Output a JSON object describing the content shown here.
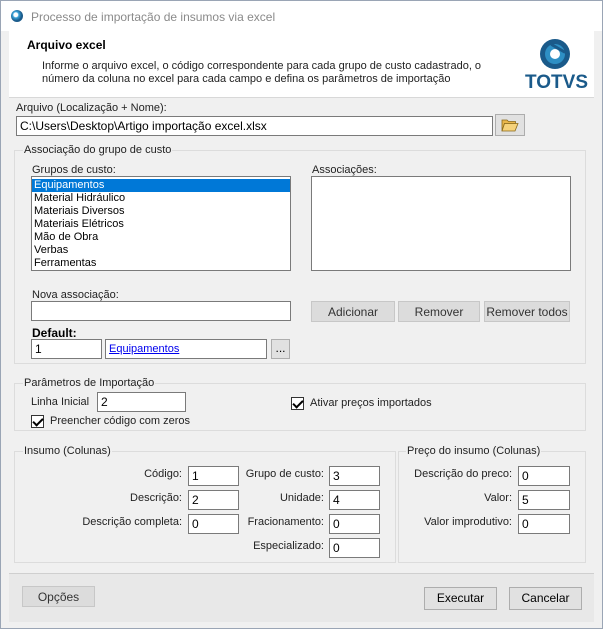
{
  "window": {
    "title": "Processo de importação de insumos via excel"
  },
  "header": {
    "title": "Arquivo excel",
    "description": "Informe o arquivo excel, o código correspondente para cada grupo de custo cadastrado, o número da coluna no excel para cada campo e defina os parâmetros de importação",
    "logo_text": "TOTVS",
    "logo_color": "#1a5a8a"
  },
  "arquivo": {
    "label": "Arquivo (Localização + Nome):",
    "value": "C:\\Users\\Desktop\\Artigo importação excel.xlsx",
    "browse_icon": "folder-open-icon"
  },
  "associacao": {
    "title": "Associação do grupo de custo",
    "grupos_label": "Grupos de custo:",
    "grupos": [
      "Equipamentos",
      "Material Hidráulico",
      "Materiais Diversos",
      "Materiais Elétricos",
      "Mão de Obra",
      "Verbas",
      "Ferramentas"
    ],
    "selected_grupo": "Equipamentos",
    "associacoes_label": "Associações:",
    "nova_label": "Nova associação:",
    "nova_value": "",
    "default_label": "Default:",
    "default_code": "1",
    "default_link": "Equipamentos",
    "ellipsis": "...",
    "btn_adicionar": "Adicionar",
    "btn_remover": "Remover",
    "btn_remover_todos": "Remover todos"
  },
  "parametros": {
    "title": "Parâmetros de Importação",
    "linha_label": "Linha Inicial",
    "linha_value": "2",
    "ativar_label": "Ativar preços importados",
    "ativar_checked": true,
    "preencher_label": "Preencher código com zeros",
    "preencher_checked": true
  },
  "insumo": {
    "title": "Insumo (Colunas)",
    "codigo_label": "Código:",
    "codigo": "1",
    "descricao_label": "Descrição:",
    "descricao": "2",
    "desc_completa_label": "Descrição completa:",
    "desc_completa": "0",
    "grupo_label": "Grupo de custo:",
    "grupo": "3",
    "unidade_label": "Unidade:",
    "unidade": "4",
    "fracionamento_label": "Fracionamento:",
    "fracionamento": "0",
    "especializado_label": "Especializado:",
    "especializado": "0"
  },
  "preco": {
    "title": "Preço do insumo (Colunas)",
    "descricao_label": "Descrição do preco:",
    "descricao": "0",
    "valor_label": "Valor:",
    "valor": "5",
    "improdutivo_label": "Valor  improdutivo:",
    "improdutivo": "0"
  },
  "footer": {
    "opcoes": "Opções",
    "executar": "Executar",
    "cancelar": "Cancelar"
  }
}
